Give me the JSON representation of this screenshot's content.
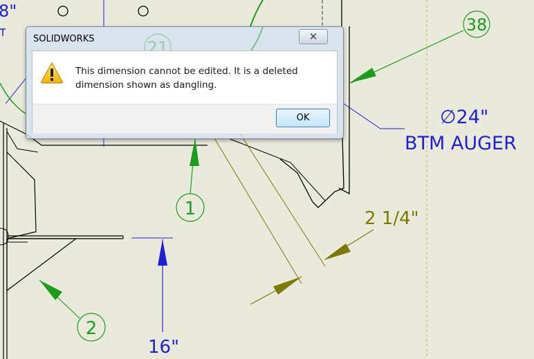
{
  "dialog": {
    "title": "SOLIDWORKS",
    "close_glyph": "✕",
    "message": "This dimension cannot be edited. It is a deleted dimension shown as dangling.",
    "ok_label": "OK",
    "icon": "warning-icon"
  },
  "drawing": {
    "balloons": {
      "b21": "21",
      "b38": "38",
      "b1": "1",
      "b2": "2"
    },
    "annotations": {
      "top_left_fragment": "8\"",
      "diameter_text": "∅24\"",
      "auger_label": "BTM AUGER",
      "dim_2_1_4": "2 1/4\"",
      "dim_16": "16\""
    }
  },
  "colors": {
    "background": "#e9eadc",
    "balloon_green": "#1a9e1a",
    "dimension_blue": "#1f1fd6",
    "dimension_olive": "#7d7a00"
  }
}
